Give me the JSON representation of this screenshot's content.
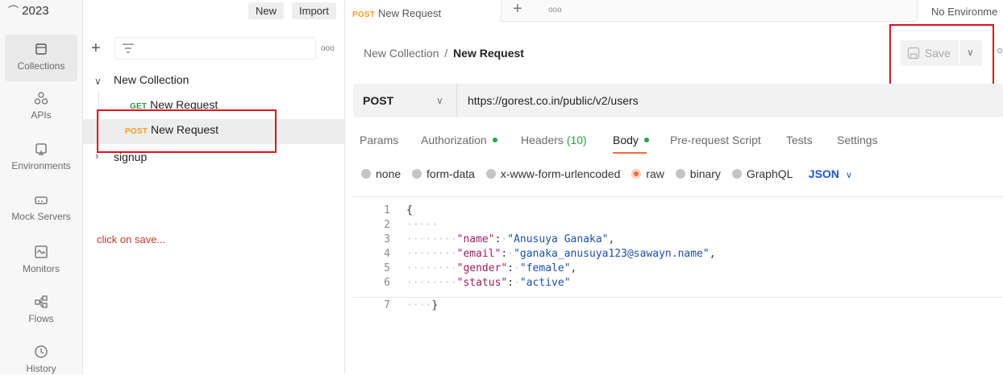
{
  "workspace": {
    "title": "2023",
    "new_label": "New",
    "import_label": "Import"
  },
  "nav": [
    {
      "label": "Collections",
      "icon": "collections-icon"
    },
    {
      "label": "APIs",
      "icon": "apis-icon"
    },
    {
      "label": "Environments",
      "icon": "environments-icon"
    },
    {
      "label": "Mock Servers",
      "icon": "mock-servers-icon"
    },
    {
      "label": "Monitors",
      "icon": "monitors-icon"
    },
    {
      "label": "Flows",
      "icon": "flows-icon"
    },
    {
      "label": "History",
      "icon": "history-icon"
    }
  ],
  "sidebar": {
    "more": "ooo",
    "collection_name": "New Collection",
    "items": [
      {
        "method": "GET",
        "name": "New Request"
      },
      {
        "method": "POST",
        "name": "New Request"
      }
    ],
    "folder": "signup"
  },
  "annotation": "click on save...",
  "tabbar": {
    "active_method": "POST",
    "active_tab": "New Request",
    "plus": "+",
    "more": "ooo",
    "environment": "No Environme"
  },
  "breadcrumb": {
    "parent": "New Collection",
    "separator": "/",
    "current": "New Request"
  },
  "save": {
    "label": "Save"
  },
  "request": {
    "method": "POST",
    "url": "https://gorest.co.in/public/v2/users"
  },
  "tabs": {
    "params": "Params",
    "authorization": "Authorization",
    "headers": "Headers",
    "headers_count": "(10)",
    "body": "Body",
    "prerequest": "Pre-request Script",
    "tests": "Tests",
    "settings": "Settings"
  },
  "body_types": {
    "none": "none",
    "form_data": "form-data",
    "urlencoded": "x-www-form-urlencoded",
    "raw": "raw",
    "binary": "binary",
    "graphql": "GraphQL",
    "format": "JSON"
  },
  "code": {
    "line_numbers": [
      "1",
      "2",
      "3",
      "4",
      "5",
      "6",
      "7"
    ],
    "l1": "{",
    "k3": "\"name\"",
    "v3": "\"Anusuya Ganaka\"",
    "k4": "\"email\"",
    "v4": "\"ganaka_anusuya123@sawayn.name\"",
    "k5": "\"gender\"",
    "v5": "\"female\"",
    "k6": "\"status\"",
    "v6": "\"active\"",
    "l7": "}"
  },
  "colors": {
    "post": "#f59b23",
    "get": "#2f9a4a",
    "accent": "#f26b3a",
    "dot": "#20a64b",
    "highlight": "#e0101f",
    "json": "#1e56c9"
  }
}
